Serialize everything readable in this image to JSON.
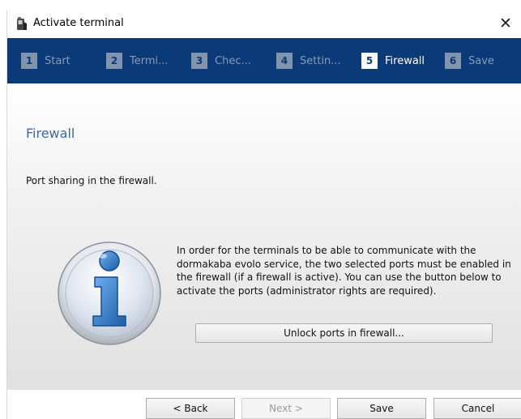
{
  "window": {
    "title": "Activate terminal",
    "close_glyph": "✕"
  },
  "steps": [
    {
      "num": "1",
      "label": "Start",
      "active": false
    },
    {
      "num": "2",
      "label": "Termi...",
      "active": false
    },
    {
      "num": "3",
      "label": "Chec...",
      "active": false
    },
    {
      "num": "4",
      "label": "Settin...",
      "active": false
    },
    {
      "num": "5",
      "label": "Firewall",
      "active": true
    },
    {
      "num": "6",
      "label": "Save",
      "active": false
    }
  ],
  "page": {
    "title": "Firewall",
    "subtitle": "Port sharing in the firewall.",
    "description": "In order for the terminals to be able to communicate with the dormakaba evolo service, the two selected ports must be enabled in the firewall (if a firewall is active). You can use the button below to activate the ports (administrator rights are required).",
    "unlock_button": "Unlock ports in firewall..."
  },
  "footer": {
    "back": "< Back",
    "next": "Next >",
    "save": "Save",
    "cancel": "Cancel"
  },
  "icons": {
    "app": "terminal-device-icon",
    "info": "info-icon",
    "close": "close-icon"
  },
  "colors": {
    "stepbar": "#0b3a78",
    "title": "#3a6aa8",
    "accent": "#2f6fb8"
  }
}
